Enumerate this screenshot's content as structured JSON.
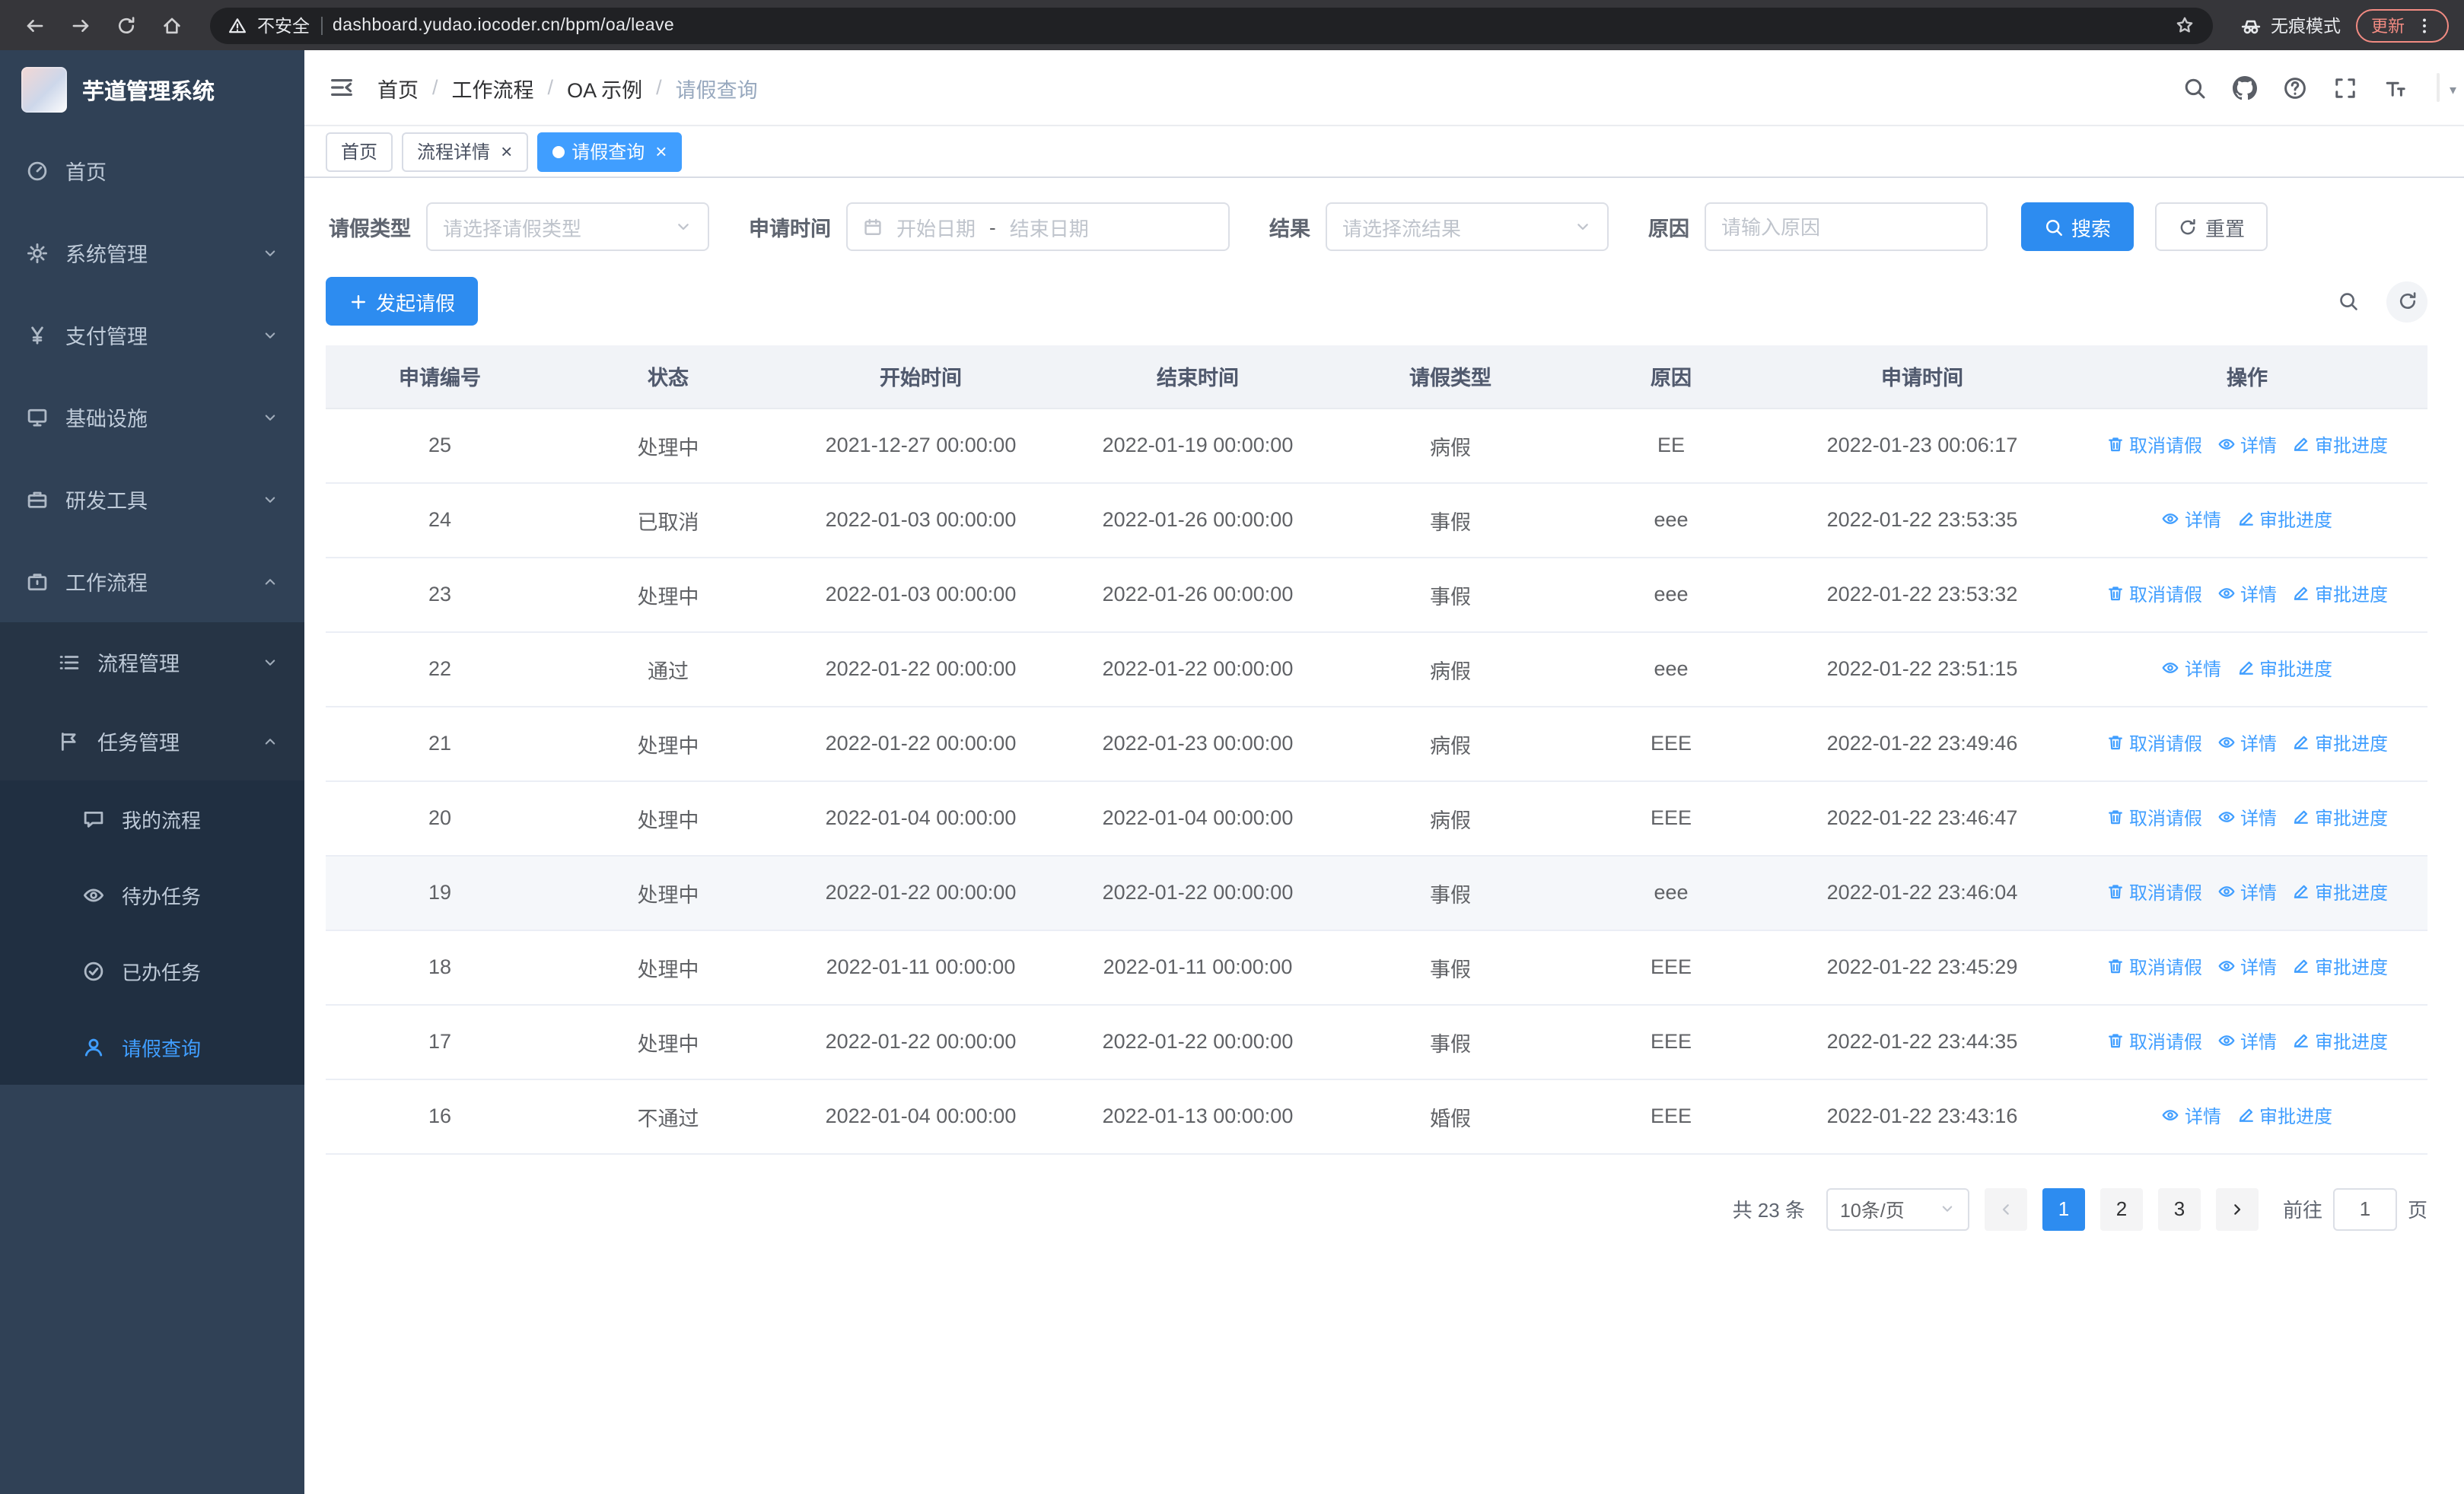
{
  "colors": {
    "primary": "#2d8cf0",
    "link": "#409eff",
    "active_tab": "#409eff",
    "sidebar_bg": "#304156",
    "sidebar_submenu_bg": "#263445",
    "chrome_bg": "#36363a"
  },
  "browser": {
    "security_warning": "不安全",
    "url": "dashboard.yudao.iocoder.cn/bpm/oa/leave",
    "incognito_label": "无痕模式",
    "update_button": "更新"
  },
  "sidebar": {
    "logo_title": "芋道管理系统",
    "menu": [
      {
        "key": "home",
        "label": "首页",
        "icon": "dashboard"
      },
      {
        "key": "system",
        "label": "系统管理",
        "icon": "gear",
        "arrow": "down"
      },
      {
        "key": "payment",
        "label": "支付管理",
        "icon": "yen",
        "arrow": "down"
      },
      {
        "key": "infra",
        "label": "基础设施",
        "icon": "monitor",
        "arrow": "down"
      },
      {
        "key": "devtools",
        "label": "研发工具",
        "icon": "toolbox",
        "arrow": "down"
      },
      {
        "key": "workflow",
        "label": "工作流程",
        "icon": "briefcase",
        "arrow": "up",
        "children": [
          {
            "key": "process-mgmt",
            "label": "流程管理",
            "icon": "list",
            "arrow": "down"
          },
          {
            "key": "task-mgmt",
            "label": "任务管理",
            "icon": "flag",
            "arrow": "up",
            "children": [
              {
                "key": "my-process",
                "label": "我的流程",
                "icon": "chat"
              },
              {
                "key": "todo-tasks",
                "label": "待办任务",
                "icon": "eye"
              },
              {
                "key": "done-tasks",
                "label": "已办任务",
                "icon": "check-circle"
              },
              {
                "key": "leave-query",
                "label": "请假查询",
                "icon": "user",
                "active": true
              }
            ]
          }
        ]
      }
    ]
  },
  "header": {
    "breadcrumb": [
      "首页",
      "工作流程",
      "OA 示例",
      "请假查询"
    ]
  },
  "tabs": [
    {
      "key": "home",
      "label": "首页",
      "closable": false
    },
    {
      "key": "process-detail",
      "label": "流程详情",
      "closable": true
    },
    {
      "key": "leave-query",
      "label": "请假查询",
      "closable": true,
      "active": true
    }
  ],
  "filters": {
    "leave_type_label": "请假类型",
    "leave_type_placeholder": "请选择请假类型",
    "apply_time_label": "申请时间",
    "start_date_placeholder": "开始日期",
    "date_separator": "-",
    "end_date_placeholder": "结束日期",
    "result_label": "结果",
    "result_placeholder": "请选择流结果",
    "reason_label": "原因",
    "reason_placeholder": "请输入原因",
    "search_button": "搜索",
    "reset_button": "重置"
  },
  "toolbar": {
    "create_button": "发起请假"
  },
  "table": {
    "columns": [
      "申请编号",
      "状态",
      "开始时间",
      "结束时间",
      "请假类型",
      "原因",
      "申请时间",
      "操作"
    ],
    "action_labels": {
      "cancel": "取消请假",
      "detail": "详情",
      "progress": "审批进度"
    },
    "rows": [
      {
        "id": "25",
        "status": "处理中",
        "start": "2021-12-27 00:00:00",
        "end": "2022-01-19 00:00:00",
        "type": "病假",
        "reason": "EE",
        "applied": "2022-01-23 00:06:17",
        "actions": [
          "cancel",
          "detail",
          "progress"
        ]
      },
      {
        "id": "24",
        "status": "已取消",
        "start": "2022-01-03 00:00:00",
        "end": "2022-01-26 00:00:00",
        "type": "事假",
        "reason": "eee",
        "applied": "2022-01-22 23:53:35",
        "actions": [
          "detail",
          "progress"
        ]
      },
      {
        "id": "23",
        "status": "处理中",
        "start": "2022-01-03 00:00:00",
        "end": "2022-01-26 00:00:00",
        "type": "事假",
        "reason": "eee",
        "applied": "2022-01-22 23:53:32",
        "actions": [
          "cancel",
          "detail",
          "progress"
        ]
      },
      {
        "id": "22",
        "status": "通过",
        "start": "2022-01-22 00:00:00",
        "end": "2022-01-22 00:00:00",
        "type": "病假",
        "reason": "eee",
        "applied": "2022-01-22 23:51:15",
        "actions": [
          "detail",
          "progress"
        ]
      },
      {
        "id": "21",
        "status": "处理中",
        "start": "2022-01-22 00:00:00",
        "end": "2022-01-23 00:00:00",
        "type": "病假",
        "reason": "EEE",
        "applied": "2022-01-22 23:49:46",
        "actions": [
          "cancel",
          "detail",
          "progress"
        ]
      },
      {
        "id": "20",
        "status": "处理中",
        "start": "2022-01-04 00:00:00",
        "end": "2022-01-04 00:00:00",
        "type": "病假",
        "reason": "EEE",
        "applied": "2022-01-22 23:46:47",
        "actions": [
          "cancel",
          "detail",
          "progress"
        ]
      },
      {
        "id": "19",
        "status": "处理中",
        "start": "2022-01-22 00:00:00",
        "end": "2022-01-22 00:00:00",
        "type": "事假",
        "reason": "eee",
        "applied": "2022-01-22 23:46:04",
        "actions": [
          "cancel",
          "detail",
          "progress"
        ],
        "highlighted": true
      },
      {
        "id": "18",
        "status": "处理中",
        "start": "2022-01-11 00:00:00",
        "end": "2022-01-11 00:00:00",
        "type": "事假",
        "reason": "EEE",
        "applied": "2022-01-22 23:45:29",
        "actions": [
          "cancel",
          "detail",
          "progress"
        ]
      },
      {
        "id": "17",
        "status": "处理中",
        "start": "2022-01-22 00:00:00",
        "end": "2022-01-22 00:00:00",
        "type": "事假",
        "reason": "EEE",
        "applied": "2022-01-22 23:44:35",
        "actions": [
          "cancel",
          "detail",
          "progress"
        ]
      },
      {
        "id": "16",
        "status": "不通过",
        "start": "2022-01-04 00:00:00",
        "end": "2022-01-13 00:00:00",
        "type": "婚假",
        "reason": "EEE",
        "applied": "2022-01-22 23:43:16",
        "actions": [
          "detail",
          "progress"
        ]
      }
    ]
  },
  "pagination": {
    "total": "共 23 条",
    "page_size": "10条/页",
    "pages": [
      "1",
      "2",
      "3"
    ],
    "active_page": "1",
    "goto_label": "前往",
    "goto_value": "1",
    "page_suffix": "页"
  }
}
